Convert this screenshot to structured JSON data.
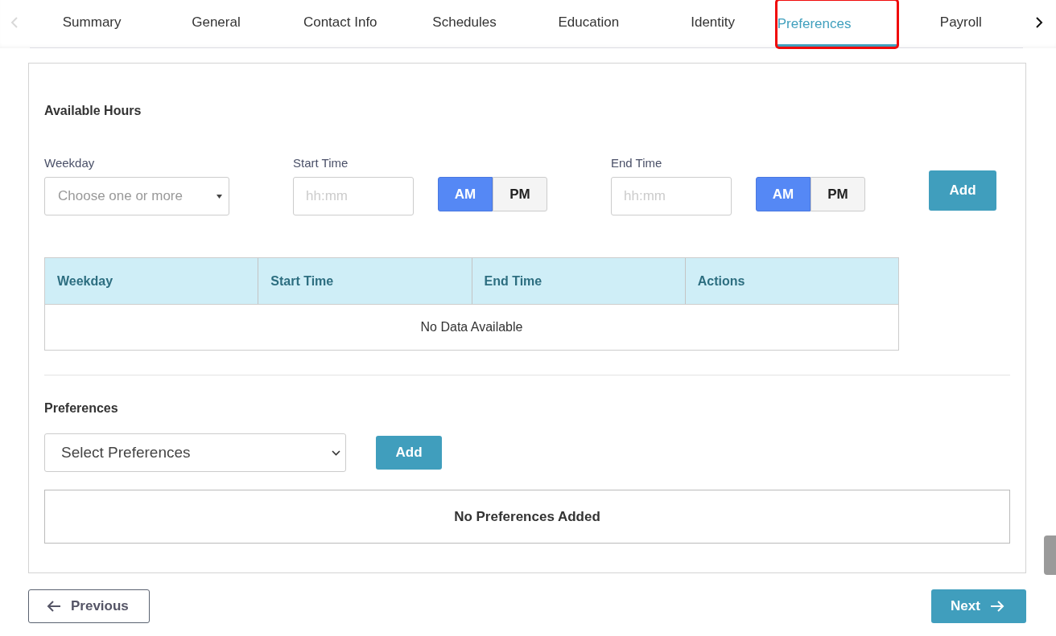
{
  "tab_nav": [
    {
      "kind": "left",
      "disabled": true
    },
    {
      "kind": "right",
      "disabled": false
    }
  ],
  "tabs": [
    {
      "label": "Summary",
      "selected": false,
      "highlighted": false
    },
    {
      "label": "General",
      "selected": false,
      "highlighted": false
    },
    {
      "label": "Contact Info",
      "selected": false,
      "highlighted": false
    },
    {
      "label": "Schedules",
      "selected": false,
      "highlighted": false
    },
    {
      "label": "Education",
      "selected": false,
      "highlighted": false
    },
    {
      "label": "Identity",
      "selected": false,
      "highlighted": false
    },
    {
      "label": "Preferences",
      "selected": true,
      "highlighted": true
    },
    {
      "label": "Payroll",
      "selected": false,
      "highlighted": false
    }
  ],
  "available_hours": {
    "title": "Available Hours",
    "weekday": {
      "label": "Weekday",
      "placeholder": "Choose one or more"
    },
    "start_time": {
      "label": "Start Time",
      "placeholder": "hh:mm",
      "periods": [
        {
          "label": "AM",
          "selected": true
        },
        {
          "label": "PM",
          "selected": false
        }
      ]
    },
    "end_time": {
      "label": "End Time",
      "placeholder": "hh:mm",
      "periods": [
        {
          "label": "AM",
          "selected": true
        },
        {
          "label": "PM",
          "selected": false
        }
      ]
    },
    "add_button": "Add",
    "table": {
      "columns": [
        "Weekday",
        "Start Time",
        "End Time",
        "Actions"
      ],
      "empty_text": "No Data Available"
    }
  },
  "preferences": {
    "title": "Preferences",
    "select_placeholder": "Select Preferences",
    "add_button": "Add",
    "empty_text": "No Preferences Added"
  },
  "footer": {
    "previous": "Previous",
    "next": "Next"
  }
}
